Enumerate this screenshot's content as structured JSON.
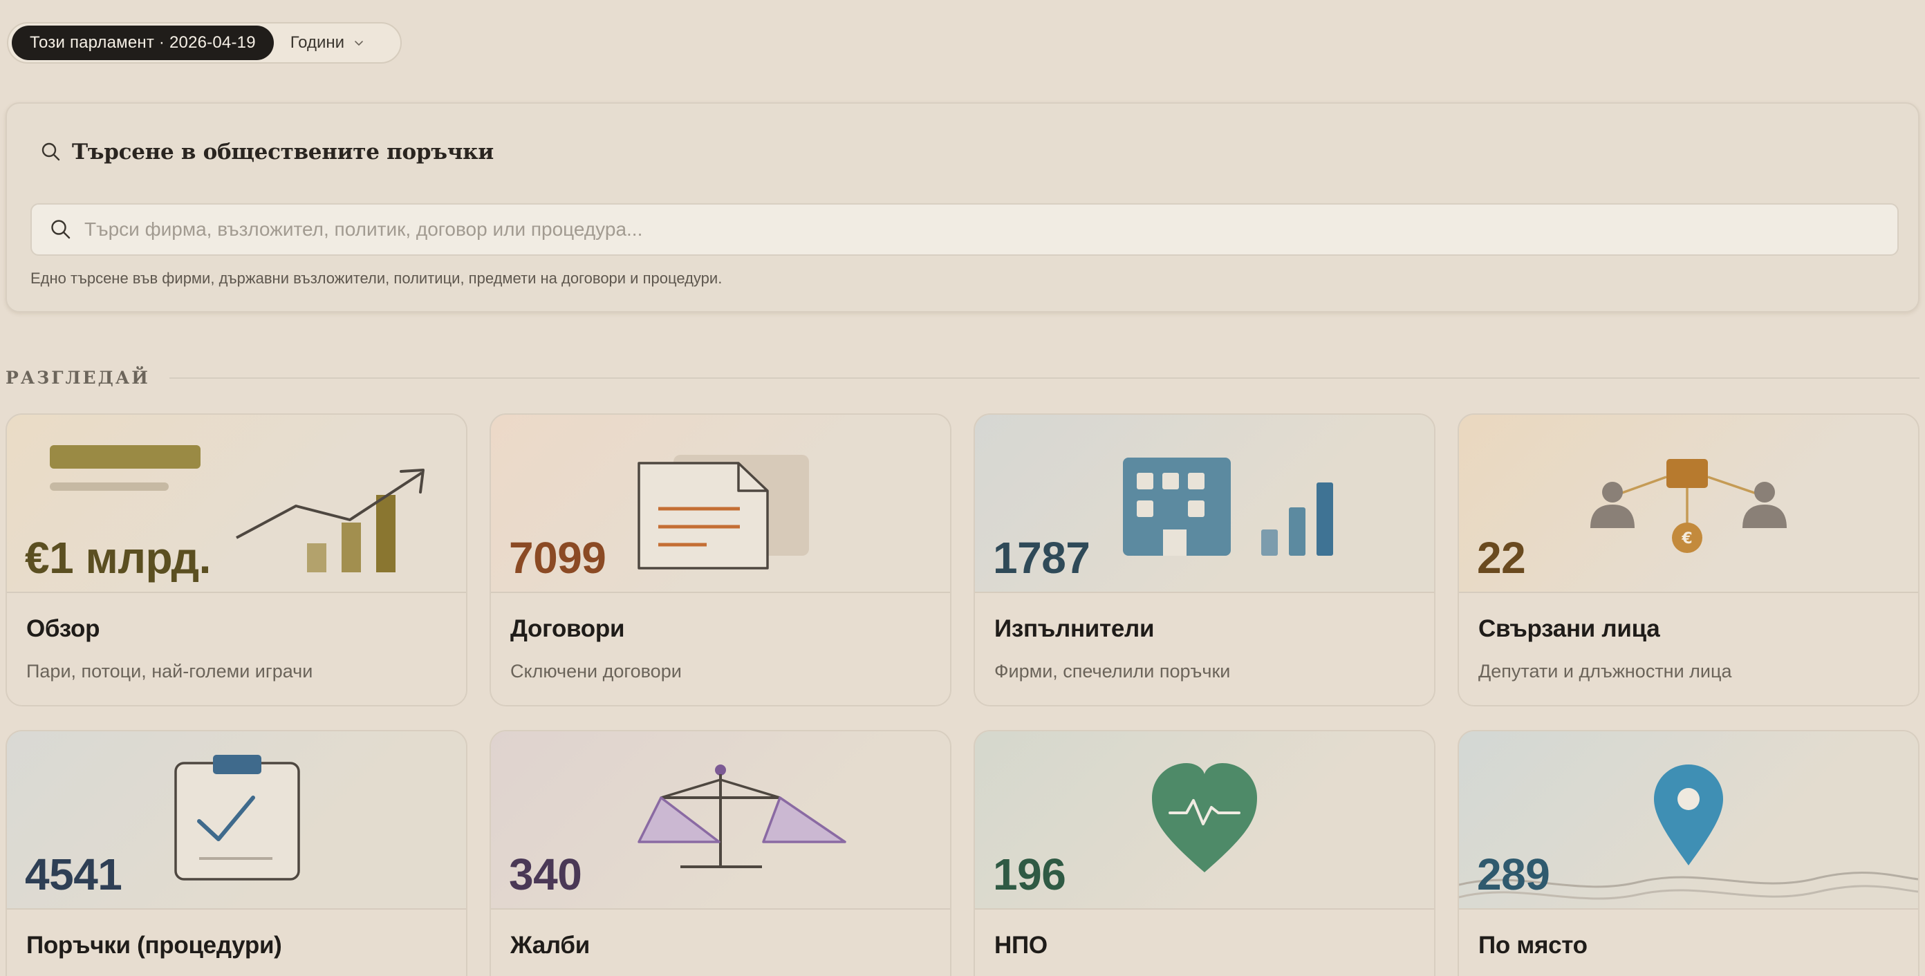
{
  "period": {
    "active_label": "Този парламент · 2026-04-19",
    "select_label": "Години"
  },
  "search": {
    "heading": "Търсене в обществените поръчки",
    "placeholder": "Търси фирма, възложител, политик, договор или процедура...",
    "hint": "Едно търсене във фирми, държавни възложители, политици, предмети на договори и процедури."
  },
  "browse": {
    "title": "РАЗГЛЕДАЙ",
    "tiles": [
      {
        "number": "€1 млрд.",
        "title": "Обзор",
        "subtitle": "Пари, потоци, най-големи играчи",
        "icon": "chart-trend-icon",
        "accent": "#5b4f21"
      },
      {
        "number": "7099",
        "title": "Договори",
        "subtitle": "Сключени договори",
        "icon": "document-icon",
        "accent": "#8b4a24"
      },
      {
        "number": "1787",
        "title": "Изпълнители",
        "subtitle": "Фирми, спечелили поръчки",
        "icon": "building-icon",
        "accent": "#2f4a58"
      },
      {
        "number": "22",
        "title": "Свързани лица",
        "subtitle": "Депутати и длъжностни лица",
        "icon": "network-icon",
        "accent": "#6a4a1f"
      },
      {
        "number": "4541",
        "title": "Поръчки (процедури)",
        "subtitle": "",
        "icon": "clipboard-check-icon",
        "accent": "#2e3f55"
      },
      {
        "number": "340",
        "title": "Жалби",
        "subtitle": "",
        "icon": "scales-icon",
        "accent": "#4a3856"
      },
      {
        "number": "196",
        "title": "НПО",
        "subtitle": "",
        "icon": "heart-pulse-icon",
        "accent": "#2f5a44"
      },
      {
        "number": "289",
        "title": "По място",
        "subtitle": "",
        "icon": "map-pin-icon",
        "accent": "#2f5a6e"
      }
    ]
  }
}
